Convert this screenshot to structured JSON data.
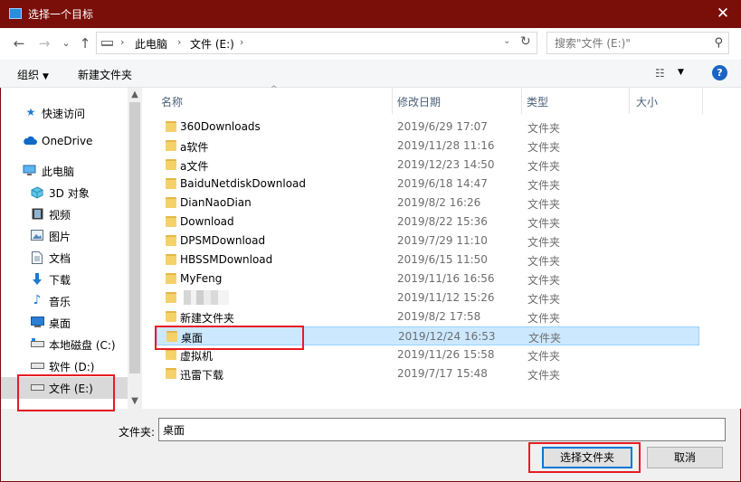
{
  "window": {
    "title": "选择一个目标",
    "close_glyph": "✕"
  },
  "nav": {
    "back_glyph": "←",
    "forward_glyph": "→",
    "recent_glyph": "⌄",
    "up_glyph": "↑",
    "breadcrumb": [
      "此电脑",
      "文件 (E:)"
    ],
    "separator_glyph": "›",
    "dropdown_glyph": "⌄",
    "refresh_glyph": "↻"
  },
  "search": {
    "placeholder": "搜索\"文件 (E:)\"",
    "icon_glyph": "⚲"
  },
  "toolbar": {
    "organize": "组织",
    "new_folder": "新建文件夹",
    "caret_glyph": "▼",
    "view_glyph": "☷",
    "help_glyph": "?"
  },
  "sidebar": {
    "items": [
      {
        "label": "快速访问",
        "icon": "star-icon"
      },
      {
        "label": "OneDrive",
        "icon": "cloud-icon"
      },
      {
        "label": "此电脑",
        "icon": "computer-icon"
      },
      {
        "label": "3D 对象",
        "icon": "cube-icon"
      },
      {
        "label": "视频",
        "icon": "video-icon"
      },
      {
        "label": "图片",
        "icon": "picture-icon"
      },
      {
        "label": "文档",
        "icon": "document-icon"
      },
      {
        "label": "下载",
        "icon": "download-icon"
      },
      {
        "label": "音乐",
        "icon": "music-icon"
      },
      {
        "label": "桌面",
        "icon": "desktop-icon"
      },
      {
        "label": "本地磁盘 (C:)",
        "icon": "drive-icon"
      },
      {
        "label": "软件 (D:)",
        "icon": "drive-icon"
      },
      {
        "label": "文件 (E:)",
        "icon": "drive-icon"
      }
    ],
    "selected_index": 12
  },
  "columns": {
    "name": "名称",
    "date": "修改日期",
    "type": "类型",
    "size": "大小",
    "sort_glyph": "^"
  },
  "files": [
    {
      "name": "360Downloads",
      "date": "2019/6/29 17:07",
      "type": "文件夹"
    },
    {
      "name": "a软件",
      "date": "2019/11/28 11:16",
      "type": "文件夹"
    },
    {
      "name": "a文件",
      "date": "2019/12/23 14:50",
      "type": "文件夹"
    },
    {
      "name": "BaiduNetdiskDownload",
      "date": "2019/6/18 14:47",
      "type": "文件夹"
    },
    {
      "name": "DianNaoDian",
      "date": "2019/8/2 16:26",
      "type": "文件夹"
    },
    {
      "name": "Download",
      "date": "2019/8/22 15:36",
      "type": "文件夹"
    },
    {
      "name": "DPSMDownload",
      "date": "2019/7/29 11:10",
      "type": "文件夹"
    },
    {
      "name": "HBSSMDownload",
      "date": "2019/6/15 11:50",
      "type": "文件夹"
    },
    {
      "name": "MyFeng",
      "date": "2019/11/16 16:56",
      "type": "文件夹"
    },
    {
      "name": "",
      "date": "2019/11/12 15:26",
      "type": "文件夹",
      "blurred": true
    },
    {
      "name": "新建文件夹",
      "date": "2019/8/2 17:58",
      "type": "文件夹"
    },
    {
      "name": "桌面",
      "date": "2019/12/24 16:53",
      "type": "文件夹"
    },
    {
      "name": "虚拟机",
      "date": "2019/11/26 15:58",
      "type": "文件夹"
    },
    {
      "name": "迅雷下载",
      "date": "2019/7/17 15:48",
      "type": "文件夹"
    }
  ],
  "selected_file_index": 11,
  "folder_field": {
    "label": "文件夹:",
    "value": "桌面"
  },
  "buttons": {
    "select_folder": "选择文件夹",
    "cancel": "取消"
  },
  "colors": {
    "titlebar": "#7a0e08",
    "selection": "#cce8ff",
    "highlight_box": "#e81b23"
  }
}
